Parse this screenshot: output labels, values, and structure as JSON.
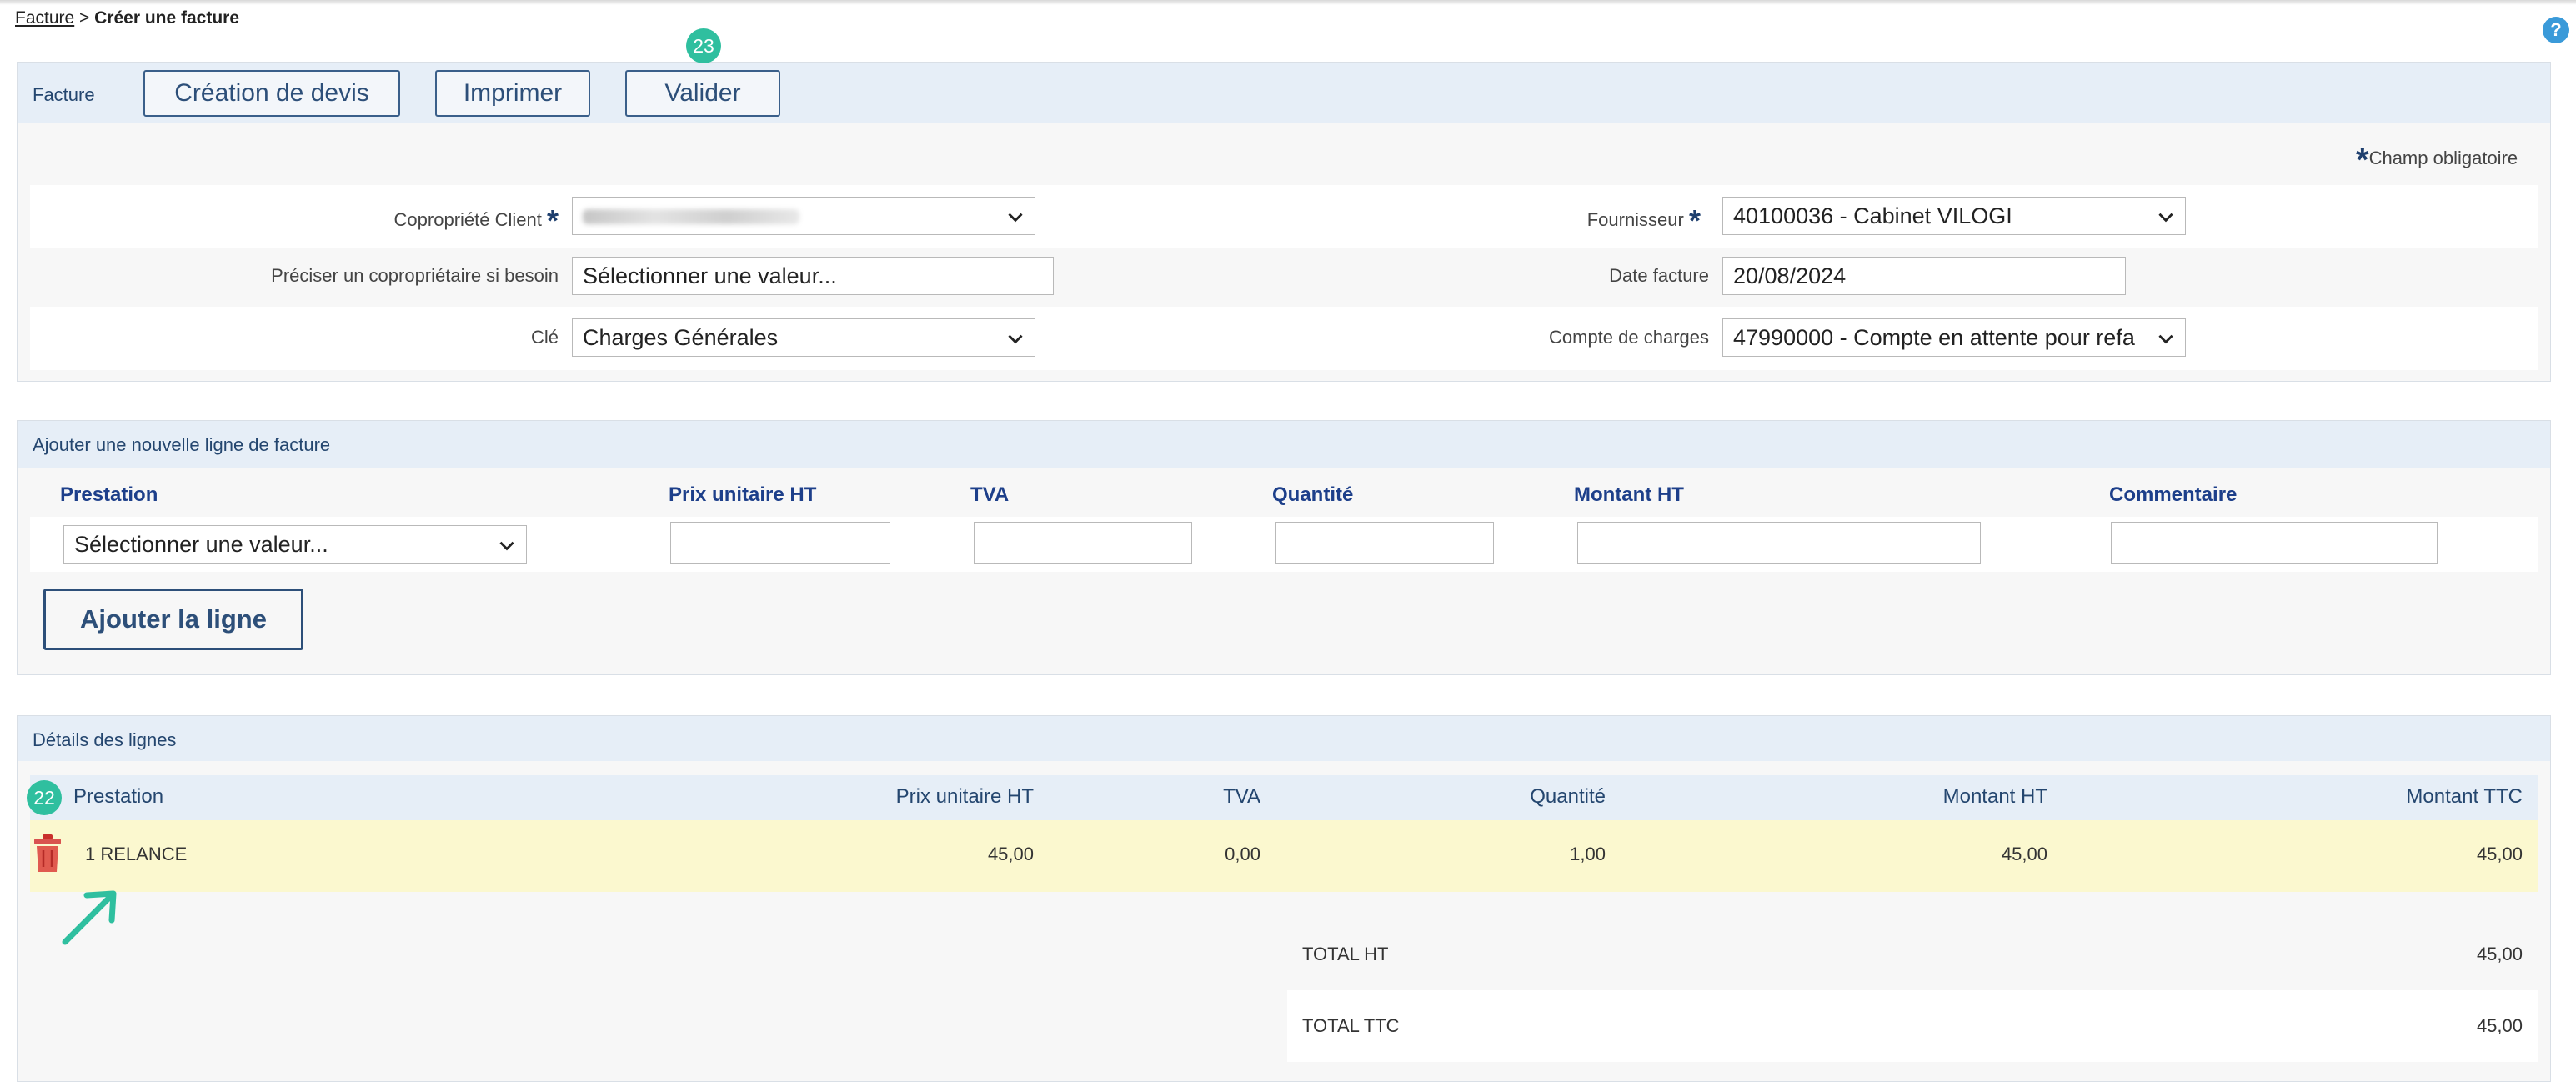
{
  "breadcrumb": {
    "link": "Facture",
    "separator": " > ",
    "current": "Créer une facture"
  },
  "help": {
    "label": "?"
  },
  "badges": {
    "toolbar": "23",
    "details": "22"
  },
  "toolbar": {
    "title": "Facture",
    "buttons": {
      "devis": "Création de devis",
      "print": "Imprimer",
      "validate": "Valider"
    }
  },
  "required_note": {
    "star": "*",
    "text": "Champ obligatoire"
  },
  "form": {
    "copro_label": "Copropriété Client",
    "copro_value": "",
    "precise_label": "Préciser un copropriétaire si besoin",
    "precise_placeholder": "Sélectionner une valeur...",
    "cle_label": "Clé",
    "cle_value": "Charges Générales",
    "fournisseur_label": "Fournisseur",
    "fournisseur_value": "40100036 - Cabinet VILOGI",
    "date_label": "Date facture",
    "date_value": "20/08/2024",
    "compte_label": "Compte de charges",
    "compte_value": "47990000 - Compte en attente pour refa"
  },
  "add_line": {
    "title": "Ajouter une nouvelle ligne de facture",
    "columns": {
      "prestation": "Prestation",
      "prix": "Prix unitaire HT",
      "tva": "TVA",
      "quantite": "Quantité",
      "montant": "Montant HT",
      "commentaire": "Commentaire"
    },
    "prestation_placeholder": "Sélectionner une valeur...",
    "button": "Ajouter la ligne"
  },
  "details": {
    "title": "Détails des lignes",
    "columns": {
      "prestation": "Prestation",
      "prix": "Prix unitaire HT",
      "tva": "TVA",
      "quantite": "Quantité",
      "montant_ht": "Montant HT",
      "montant_ttc": "Montant TTC"
    },
    "rows": [
      {
        "prestation": "1 RELANCE",
        "prix": "45,00",
        "tva": "0,00",
        "quantite": "1,00",
        "montant_ht": "45,00",
        "montant_ttc": "45,00"
      }
    ],
    "totals": [
      {
        "label": "TOTAL HT",
        "value": "45,00"
      },
      {
        "label": "TOTAL TTC",
        "value": "45,00"
      }
    ]
  },
  "colors": {
    "accent": "#2d4f79",
    "badge": "#2fbf9f",
    "highlight_row": "#fbf8cf",
    "panel_header": "#e6eef7"
  }
}
